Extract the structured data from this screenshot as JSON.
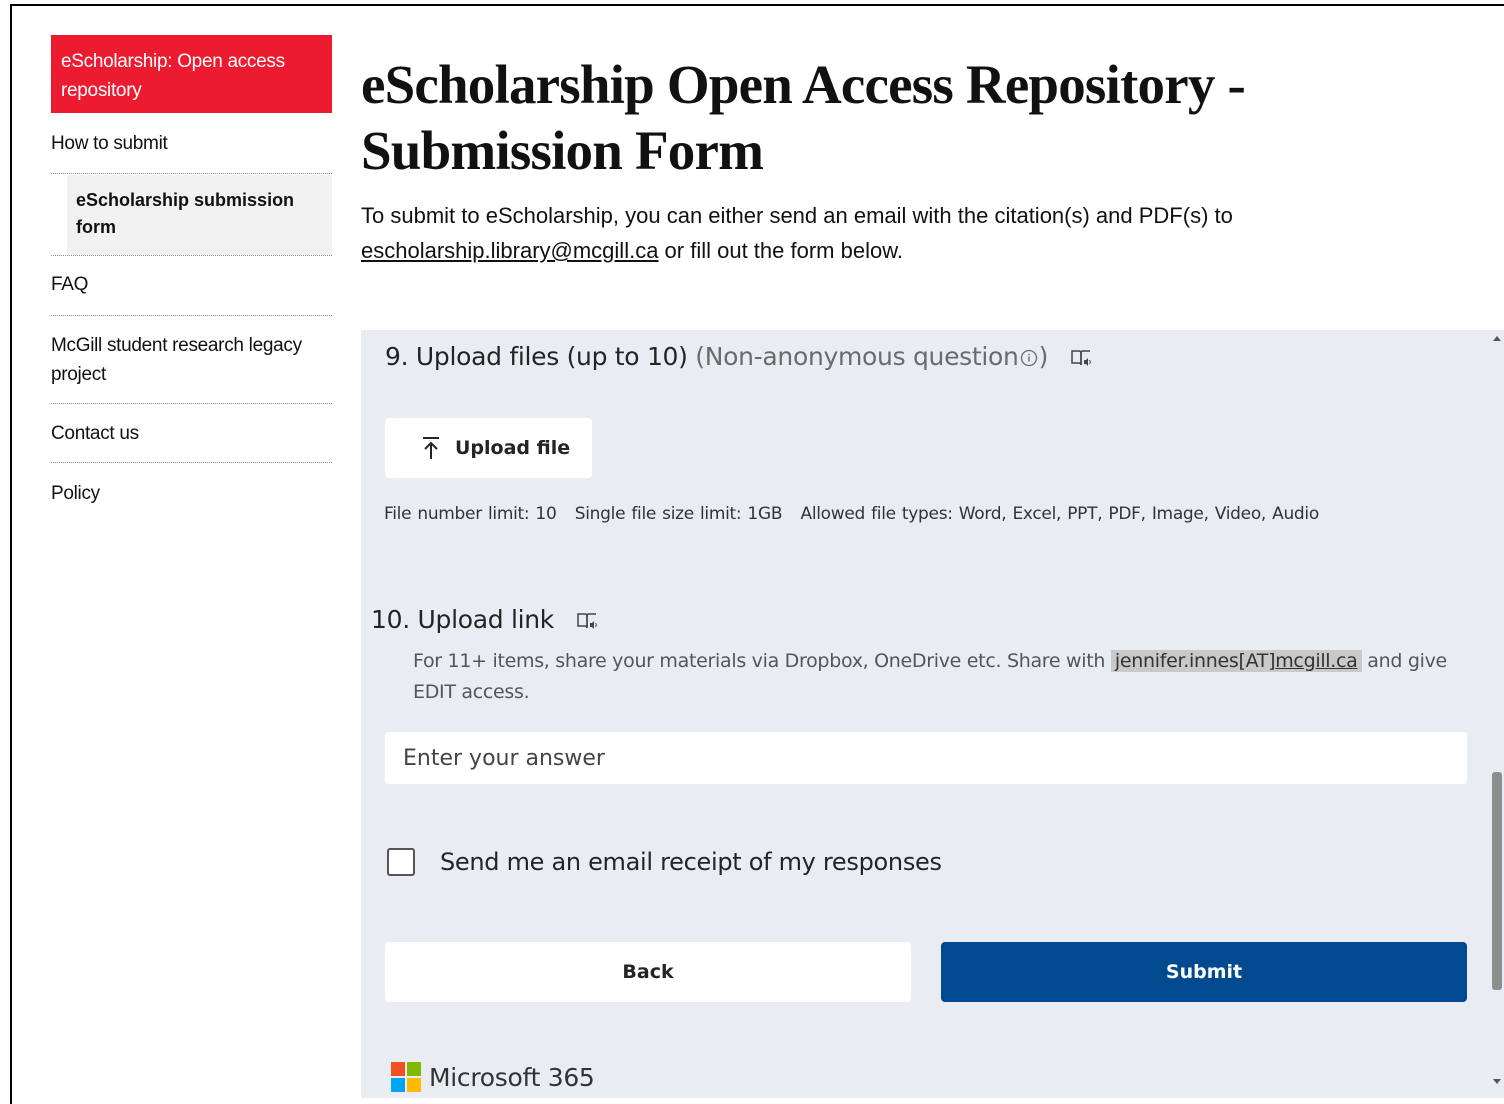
{
  "sidebar": {
    "header": "eScholarship: Open access repository",
    "items": [
      {
        "label": "How to submit"
      },
      {
        "label": "eScholarship submission form"
      },
      {
        "label": "FAQ"
      },
      {
        "label": "McGill student research legacy project"
      },
      {
        "label": "Contact us"
      },
      {
        "label": "Policy"
      }
    ]
  },
  "page": {
    "title": "eScholarship Open Access Repository - Submission Form",
    "intro_before": "To submit to eScholarship, you can either send an email with the citation(s) and PDF(s) to ",
    "intro_email": "escholarship.library@mcgill.ca",
    "intro_after": " or fill out the form below."
  },
  "form": {
    "q9": {
      "title": "9. Upload files (up to 10)",
      "note": "(Non-anonymous question",
      "note_close": ")",
      "upload_label": "Upload file",
      "file_info": "File number limit: 10   Single file size limit: 1GB   Allowed file types: Word, Excel, PPT, PDF, Image, Video, Audio"
    },
    "q10": {
      "title": "10. Upload link",
      "desc_before": "For 11+ items, share your materials via Dropbox, OneDrive etc. Share with ",
      "share_user": "jennifer.innes[AT]",
      "share_domain": "mcgill.ca",
      "desc_after": " and give EDIT access.",
      "placeholder": "Enter your answer"
    },
    "receipt_label": "Send me an email receipt of my responses",
    "back_label": "Back",
    "submit_label": "Submit",
    "brand": "Microsoft 365"
  },
  "colors": {
    "sidebar_header": "#ed1b2f",
    "form_bg": "#e9edf3",
    "submit": "#024a8f",
    "ms_red": "#f25022",
    "ms_green": "#7fba00",
    "ms_blue": "#00a4ef",
    "ms_yellow": "#ffb900"
  }
}
